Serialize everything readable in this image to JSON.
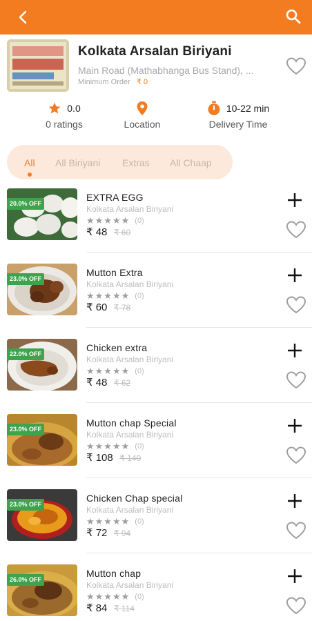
{
  "header": {
    "back_icon": "chevron-left-icon",
    "search_icon": "search-icon",
    "color": "#f47c20"
  },
  "restaurant": {
    "name": "Kolkata Arsalan Biriyani",
    "address": "Main Road (Mathabhanga Bus Stand), ...",
    "minimum_order_label": "Minimum Order",
    "minimum_order_value": "₹ 0",
    "favorite_icon": "heart-outline-icon"
  },
  "stats": {
    "rating_value": "0.0",
    "rating_label": "0 ratings",
    "location_label": "Location",
    "delivery_value": "10-22 min",
    "delivery_label": "Delivery Time"
  },
  "tabs": [
    {
      "label": "All",
      "active": true
    },
    {
      "label": "All Biriyani",
      "active": false
    },
    {
      "label": "Extras",
      "active": false
    },
    {
      "label": "All Chaap",
      "active": false
    }
  ],
  "items": [
    {
      "name": "EXTRA EGG",
      "restaurant": "Kolkata Arsalan Biriyani",
      "stars": "★★★★★",
      "rating_count": "(0)",
      "price": "₹ 48",
      "old_price": "₹ 60",
      "discount": "20.0% OFF"
    },
    {
      "name": "Mutton Extra",
      "restaurant": "Kolkata Arsalan Biriyani",
      "stars": "★★★★★",
      "rating_count": "(0)",
      "price": "₹ 60",
      "old_price": "₹ 78",
      "discount": "23.0% OFF"
    },
    {
      "name": "Chicken extra",
      "restaurant": "Kolkata Arsalan Biriyani",
      "stars": "★★★★★",
      "rating_count": "(0)",
      "price": "₹ 48",
      "old_price": "₹ 62",
      "discount": "22.0% OFF"
    },
    {
      "name": "Mutton chap Special",
      "restaurant": "Kolkata Arsalan Biriyani",
      "stars": "★★★★★",
      "rating_count": "(0)",
      "price": "₹ 108",
      "old_price": "₹ 140",
      "discount": "23.0% OFF"
    },
    {
      "name": "Chicken Chap special",
      "restaurant": "Kolkata Arsalan Biriyani",
      "stars": "★★★★★",
      "rating_count": "(0)",
      "price": "₹ 72",
      "old_price": "₹ 94",
      "discount": "23.0% OFF"
    },
    {
      "name": "Mutton chap",
      "restaurant": "Kolkata Arsalan Biriyani",
      "stars": "★★★★★",
      "rating_count": "(0)",
      "price": "₹ 84",
      "old_price": "₹ 114",
      "discount": "26.0% OFF"
    }
  ],
  "colors": {
    "accent": "#f47c20",
    "badge": "#3fa34d",
    "muted": "#bdbdbd"
  }
}
